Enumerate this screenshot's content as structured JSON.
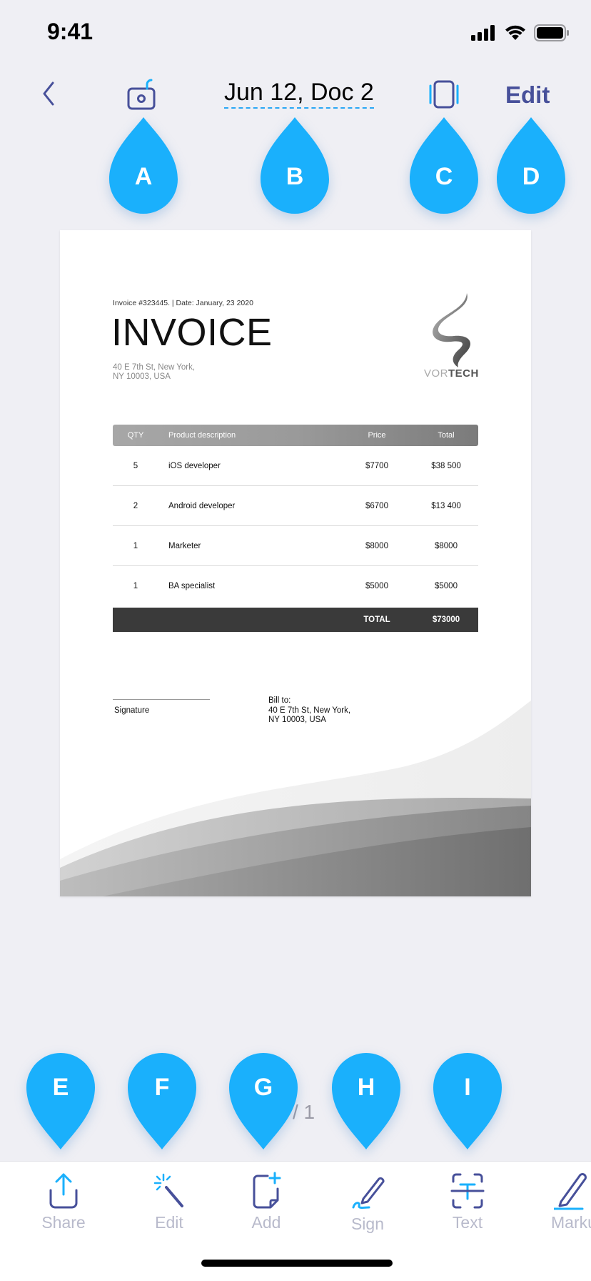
{
  "status": {
    "time": "9:41"
  },
  "nav": {
    "title": "Jun 12, Doc 2",
    "edit_label": "Edit"
  },
  "pins": {
    "a": "A",
    "b": "B",
    "c": "C",
    "d": "D",
    "e": "E",
    "f": "F",
    "g": "G",
    "h": "H",
    "i": "I"
  },
  "invoice": {
    "meta": "Invoice #323445. |  Date: January, 23  2020",
    "title": "INVOICE",
    "address_line1": "40 E 7th St, New York,",
    "address_line2": "NY 10003, USA",
    "logo_light": "VOR",
    "logo_bold": "TECH",
    "table": {
      "headers": {
        "qty": "QTY",
        "desc": "Product description",
        "price": "Price",
        "total": "Total"
      },
      "rows": [
        {
          "qty": "5",
          "desc": "iOS developer",
          "price": "$7700",
          "total": "$38 500"
        },
        {
          "qty": "2",
          "desc": "Android developer",
          "price": "$6700",
          "total": "$13 400"
        },
        {
          "qty": "1",
          "desc": "Marketer",
          "price": "$8000",
          "total": "$8000"
        },
        {
          "qty": "1",
          "desc": "BA specialist",
          "price": "$5000",
          "total": "$5000"
        }
      ],
      "total_label": "TOTAL",
      "total_value": "$73000"
    },
    "signature_label": "Signature",
    "bill_to_label": "Bill to:",
    "bill_to_line1": "40 E 7th St, New York,",
    "bill_to_line2": "NY 10003, USA"
  },
  "page_count": "/ 1",
  "toolbar": {
    "share": "Share",
    "edit": "Edit",
    "add": "Add",
    "sign": "Sign",
    "text": "Text",
    "markup": "Marku"
  },
  "colors": {
    "accent": "#1AB0FC",
    "nav_icon": "#47509A",
    "toolbar_label": "#B8BACB"
  }
}
